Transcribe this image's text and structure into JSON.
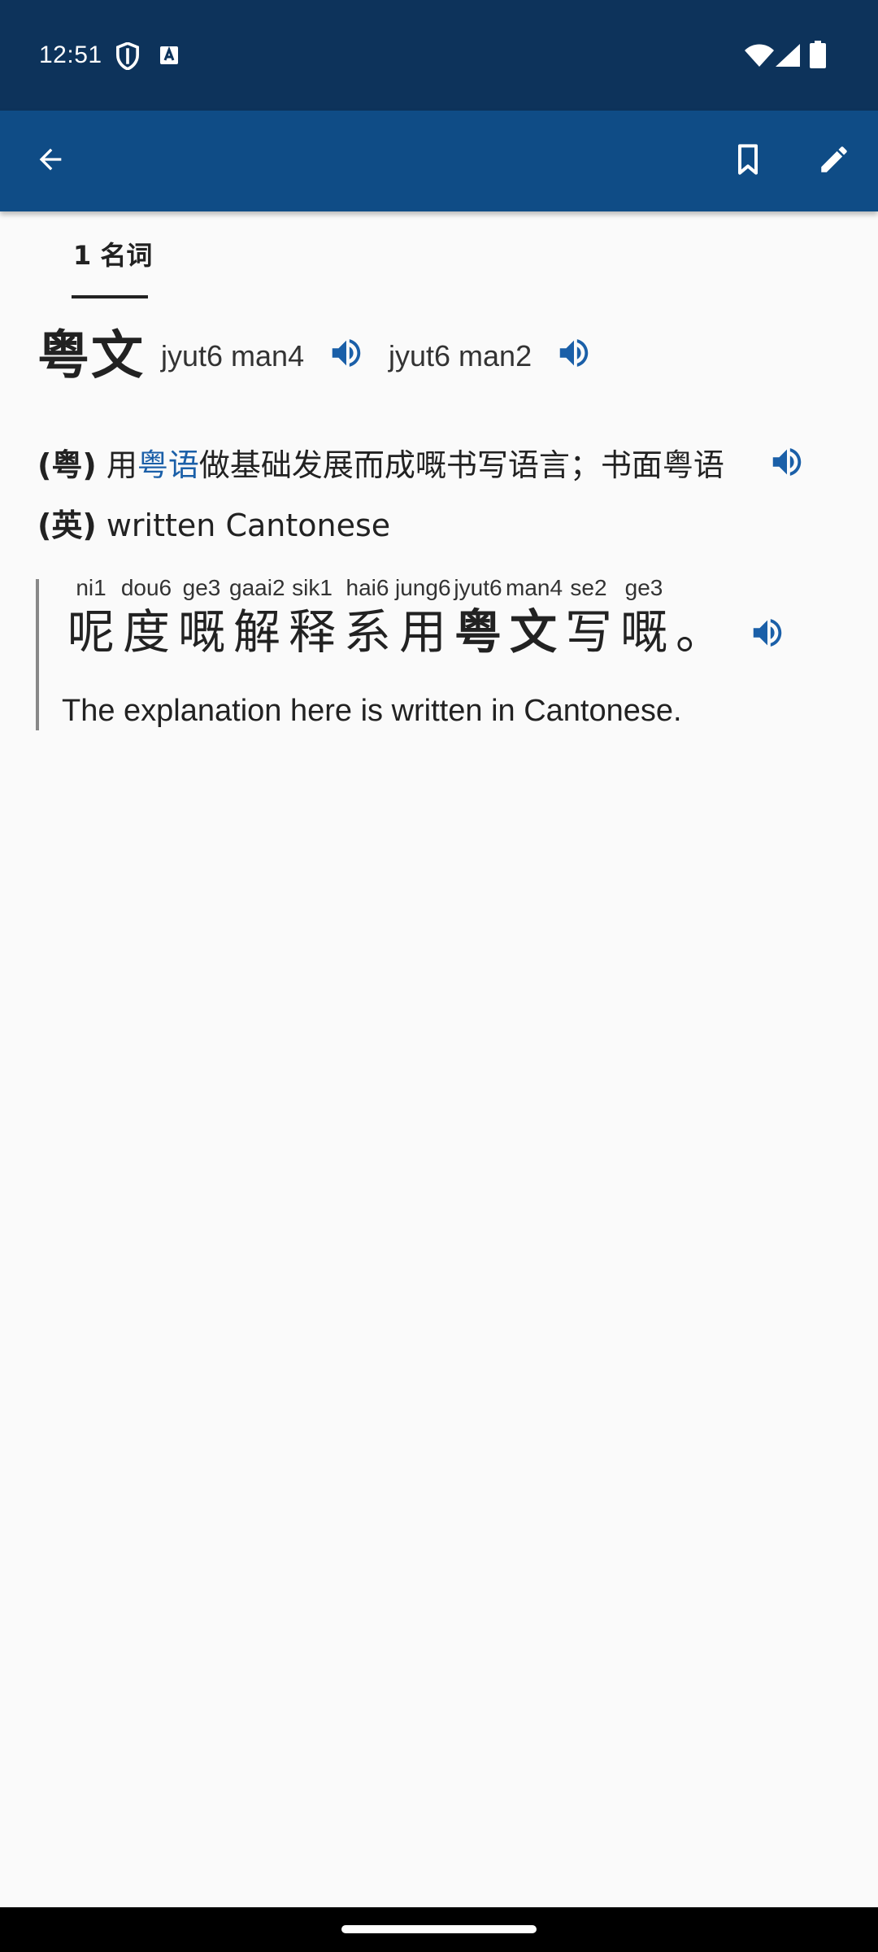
{
  "status_bar": {
    "time": "12:51",
    "icons": [
      "shield-icon",
      "keyboard-a-icon",
      "wifi-icon",
      "signal-icon",
      "battery-icon"
    ]
  },
  "app_bar": {
    "icons": [
      "back-arrow-icon",
      "bookmark-icon",
      "edit-pencil-icon"
    ],
    "color": "#0f4c86"
  },
  "tab": {
    "label": "1 名词"
  },
  "entry": {
    "headword": "粤文",
    "pronunciations": [
      "jyut6 man4",
      "jyut6 man2"
    ],
    "definitions": {
      "yue": {
        "tag": "(粤)",
        "prefix": "用",
        "link": "粤语",
        "suffix": "做基础发展而成嘅书写语言；书面粤语"
      },
      "eng": {
        "tag": "(英)",
        "text": "written Cantonese"
      }
    },
    "example": {
      "chars": [
        {
          "jyutping": "ni1",
          "char": "呢",
          "highlight": false
        },
        {
          "jyutping": "dou6",
          "char": "度",
          "highlight": false
        },
        {
          "jyutping": "ge3",
          "char": "嘅",
          "highlight": false
        },
        {
          "jyutping": "gaai2",
          "char": "解",
          "highlight": false
        },
        {
          "jyutping": "sik1",
          "char": "释",
          "highlight": false
        },
        {
          "jyutping": "hai6",
          "char": "系",
          "highlight": false
        },
        {
          "jyutping": "jung6",
          "char": "用",
          "highlight": false
        },
        {
          "jyutping": "jyut6",
          "char": "粤",
          "highlight": true
        },
        {
          "jyutping": "man4",
          "char": "文",
          "highlight": true
        },
        {
          "jyutping": "se2",
          "char": "写",
          "highlight": false
        },
        {
          "jyutping": "ge3",
          "char": "嘅",
          "highlight": false
        },
        {
          "jyutping": "",
          "char": "。",
          "highlight": false
        }
      ],
      "translation": "The explanation here is written in Cantonese."
    }
  },
  "colors": {
    "accent": "#1a5fa8",
    "status_bar": "#0d335b",
    "background": "#fafafa"
  }
}
